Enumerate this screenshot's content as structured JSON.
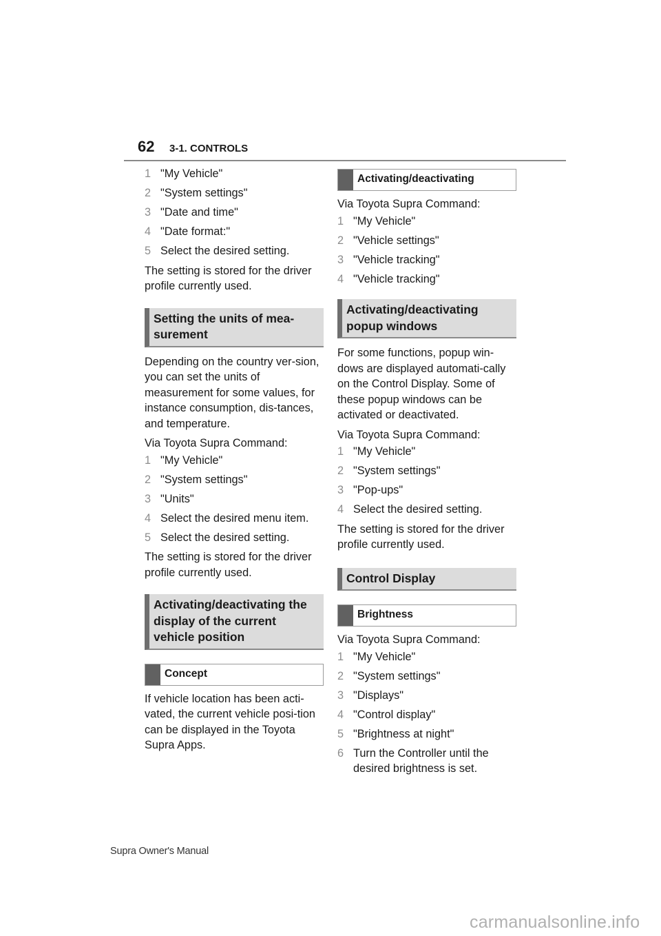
{
  "header": {
    "page_number": "62",
    "section": "3-1. CONTROLS"
  },
  "left": {
    "steps_a": [
      {
        "n": "1",
        "t": "\"My Vehicle\""
      },
      {
        "n": "2",
        "t": "\"System settings\""
      },
      {
        "n": "3",
        "t": "\"Date and time\""
      },
      {
        "n": "4",
        "t": "\"Date format:\""
      },
      {
        "n": "5",
        "t": "Select the desired setting."
      }
    ],
    "stored_a": "The setting is stored for the driver profile currently used.",
    "units_heading": "Setting the units of mea-surement",
    "units_body": "Depending on the country ver-sion, you can set the units of measurement for some values, for instance consumption, dis-tances, and temperature.",
    "via_a": "Via Toyota Supra Command:",
    "steps_b": [
      {
        "n": "1",
        "t": "\"My Vehicle\""
      },
      {
        "n": "2",
        "t": "\"System settings\""
      },
      {
        "n": "3",
        "t": "\"Units\""
      },
      {
        "n": "4",
        "t": "Select the desired menu item."
      },
      {
        "n": "5",
        "t": "Select the desired setting."
      }
    ],
    "stored_b": "The setting is stored for the driver profile currently used.",
    "position_heading": "Activating/deactivating the display of the current vehicle position",
    "concept_heading": "Concept",
    "concept_body": "If vehicle location has been acti-vated, the current vehicle posi-tion can be displayed in the Toyota Supra Apps."
  },
  "right": {
    "act_heading": "Activating/deactivating",
    "via_a": "Via Toyota Supra Command:",
    "steps_a": [
      {
        "n": "1",
        "t": "\"My Vehicle\""
      },
      {
        "n": "2",
        "t": "\"Vehicle settings\""
      },
      {
        "n": "3",
        "t": "\"Vehicle tracking\""
      },
      {
        "n": "4",
        "t": "\"Vehicle tracking\""
      }
    ],
    "popup_heading": "Activating/deactivating popup windows",
    "popup_body": "For some functions, popup win-dows are displayed automati-cally on the Control Display. Some of these popup windows can be activated or deactivated.",
    "via_b": "Via Toyota Supra Command:",
    "steps_b": [
      {
        "n": "1",
        "t": "\"My Vehicle\""
      },
      {
        "n": "2",
        "t": "\"System settings\""
      },
      {
        "n": "3",
        "t": "\"Pop-ups\""
      },
      {
        "n": "4",
        "t": "Select the desired setting."
      }
    ],
    "stored_b": "The setting is stored for the driver profile currently used.",
    "control_heading": "Control Display",
    "brightness_heading": "Brightness",
    "via_c": "Via Toyota Supra Command:",
    "steps_c": [
      {
        "n": "1",
        "t": "\"My Vehicle\""
      },
      {
        "n": "2",
        "t": "\"System settings\""
      },
      {
        "n": "3",
        "t": "\"Displays\""
      },
      {
        "n": "4",
        "t": "\"Control display\""
      },
      {
        "n": "5",
        "t": "\"Brightness at night\""
      },
      {
        "n": "6",
        "t": "Turn the Controller until the desired brightness is set."
      }
    ]
  },
  "footer": {
    "manual_title": "Supra Owner's Manual",
    "watermark": "carmanualsonline.info"
  }
}
